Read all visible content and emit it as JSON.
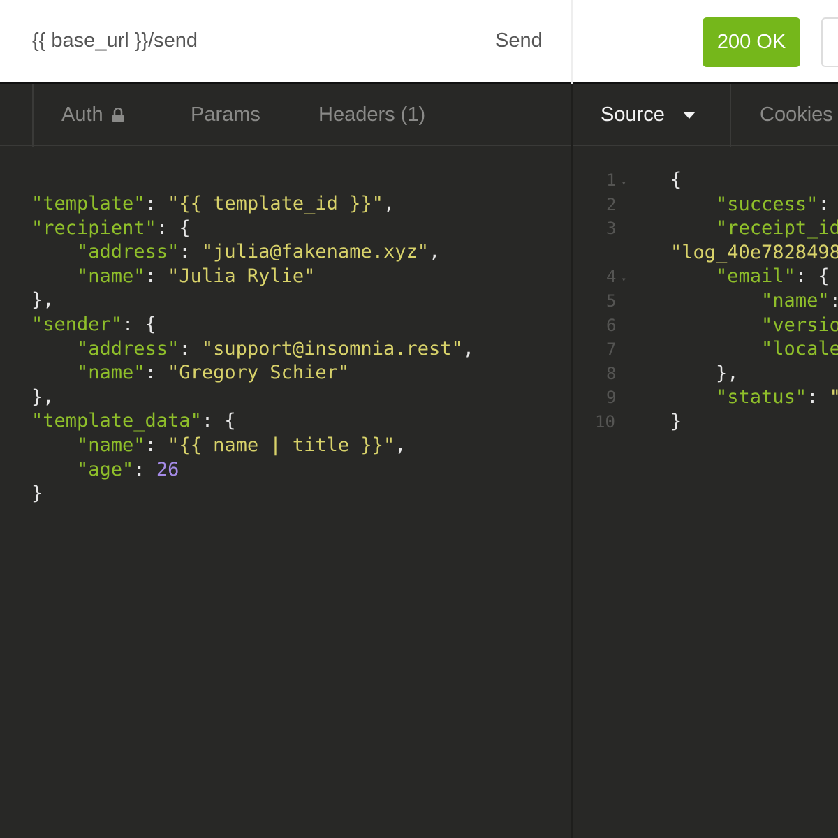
{
  "request": {
    "url": "{{ base_url }}/send",
    "send_label": "Send",
    "tabs": [
      {
        "label": "Auth",
        "icon": "lock-icon"
      },
      {
        "label": "Params"
      },
      {
        "label": "Headers (1)"
      }
    ],
    "body_lines": [
      {
        "i": 0,
        "t": [
          [
            "k",
            "\"template\""
          ],
          [
            "p",
            ": "
          ],
          [
            "s",
            "\"{{ template_id }}\""
          ],
          [
            "p",
            ","
          ]
        ]
      },
      {
        "i": 0,
        "t": [
          [
            "k",
            "\"recipient\""
          ],
          [
            "p",
            ": {"
          ]
        ]
      },
      {
        "i": 1,
        "t": [
          [
            "k",
            "\"address\""
          ],
          [
            "p",
            ": "
          ],
          [
            "s",
            "\"julia@fakename.xyz\""
          ],
          [
            "p",
            ","
          ]
        ]
      },
      {
        "i": 1,
        "t": [
          [
            "k",
            "\"name\""
          ],
          [
            "p",
            ": "
          ],
          [
            "s",
            "\"Julia Rylie\""
          ]
        ]
      },
      {
        "i": 0,
        "t": [
          [
            "p",
            "},"
          ]
        ]
      },
      {
        "i": 0,
        "t": [
          [
            "k",
            "\"sender\""
          ],
          [
            "p",
            ": {"
          ]
        ]
      },
      {
        "i": 1,
        "t": [
          [
            "k",
            "\"address\""
          ],
          [
            "p",
            ": "
          ],
          [
            "s",
            "\"support@insomnia.rest\""
          ],
          [
            "p",
            ","
          ]
        ]
      },
      {
        "i": 1,
        "t": [
          [
            "k",
            "\"name\""
          ],
          [
            "p",
            ": "
          ],
          [
            "s",
            "\"Gregory Schier\""
          ]
        ]
      },
      {
        "i": 0,
        "t": [
          [
            "p",
            "},"
          ]
        ]
      },
      {
        "i": 0,
        "t": [
          [
            "k",
            "\"template_data\""
          ],
          [
            "p",
            ": {"
          ]
        ]
      },
      {
        "i": 1,
        "t": [
          [
            "k",
            "\"name\""
          ],
          [
            "p",
            ": "
          ],
          [
            "s",
            "\"{{ name | title }}\""
          ],
          [
            "p",
            ","
          ]
        ]
      },
      {
        "i": 1,
        "t": [
          [
            "k",
            "\"age\""
          ],
          [
            "p",
            ": "
          ],
          [
            "n",
            "26"
          ]
        ]
      },
      {
        "i": 0,
        "t": [
          [
            "p",
            "}"
          ]
        ]
      }
    ]
  },
  "response": {
    "status": "200 OK",
    "status_color": "#75b71b",
    "tabs": [
      {
        "label": "Source",
        "icon": "caret-down-icon"
      },
      {
        "label": "Cookies"
      }
    ],
    "gutter": [
      "1",
      "2",
      "3",
      "",
      "4",
      "5",
      "6",
      "7",
      "8",
      "9",
      "10"
    ],
    "lines": [
      {
        "i": 0,
        "t": [
          [
            "p",
            "{"
          ]
        ]
      },
      {
        "i": 1,
        "t": [
          [
            "k",
            "\"success\""
          ],
          [
            "p",
            ":"
          ]
        ]
      },
      {
        "i": 1,
        "t": [
          [
            "k",
            "\"receipt_id"
          ]
        ]
      },
      {
        "i": 0,
        "t": [
          [
            "s",
            "\"log_40e7828498"
          ]
        ]
      },
      {
        "i": 1,
        "t": [
          [
            "k",
            "\"email\""
          ],
          [
            "p",
            ": {"
          ]
        ]
      },
      {
        "i": 2,
        "t": [
          [
            "k",
            "\"name\""
          ],
          [
            "p",
            ":"
          ]
        ]
      },
      {
        "i": 2,
        "t": [
          [
            "k",
            "\"versio"
          ]
        ]
      },
      {
        "i": 2,
        "t": [
          [
            "k",
            "\"locale"
          ]
        ]
      },
      {
        "i": 1,
        "t": [
          [
            "p",
            "},"
          ]
        ]
      },
      {
        "i": 1,
        "t": [
          [
            "k",
            "\"status\""
          ],
          [
            "p",
            ": "
          ],
          [
            "s",
            "\""
          ]
        ]
      },
      {
        "i": 0,
        "t": [
          [
            "p",
            "}"
          ]
        ]
      }
    ]
  }
}
